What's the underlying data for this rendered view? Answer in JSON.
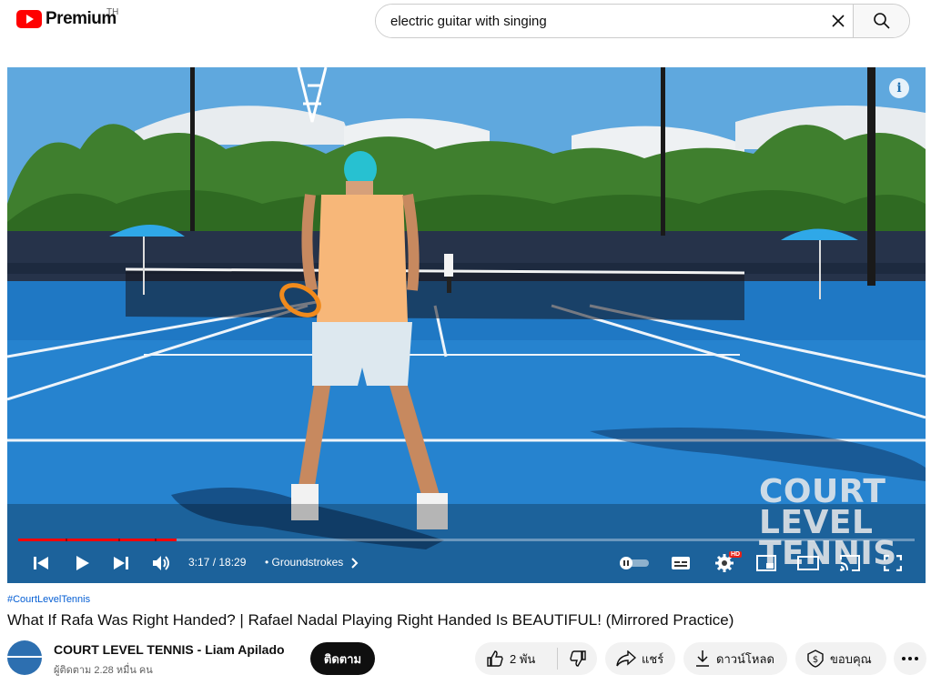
{
  "header": {
    "logo_text": "Premium",
    "country_code": "TH",
    "search_value": "electric guitar with singing"
  },
  "player": {
    "current_time": "3:17",
    "duration": "18:29",
    "time_display": "3:17 / 18:29",
    "chapter": "• Groundstrokes",
    "progress_fraction": 0.177,
    "hd_badge": "HD",
    "watermark_line1": "COURT",
    "watermark_line2": "LEVEL",
    "watermark_line3": "TENNIS"
  },
  "video": {
    "hashtag": "#CourtLevelTennis",
    "title": "What If Rafa Was Right Handed? | Rafael Nadal Playing Right Handed Is BEAUTIFUL! (Mirrored Practice)"
  },
  "channel": {
    "name": "COURT LEVEL TENNIS - Liam Apilado",
    "subscribers": "ผู้ติดตาม 2.28 หมื่น คน",
    "subscribe_label": "ติดตาม"
  },
  "actions": {
    "like_count": "2 พัน",
    "share_label": "แชร์",
    "download_label": "ดาวน์โหลด",
    "thanks_label": "ขอบคุณ"
  },
  "colors": {
    "accent_red": "#ff0000",
    "link_blue": "#065fd4",
    "court_blue": "#1e6fb0"
  }
}
